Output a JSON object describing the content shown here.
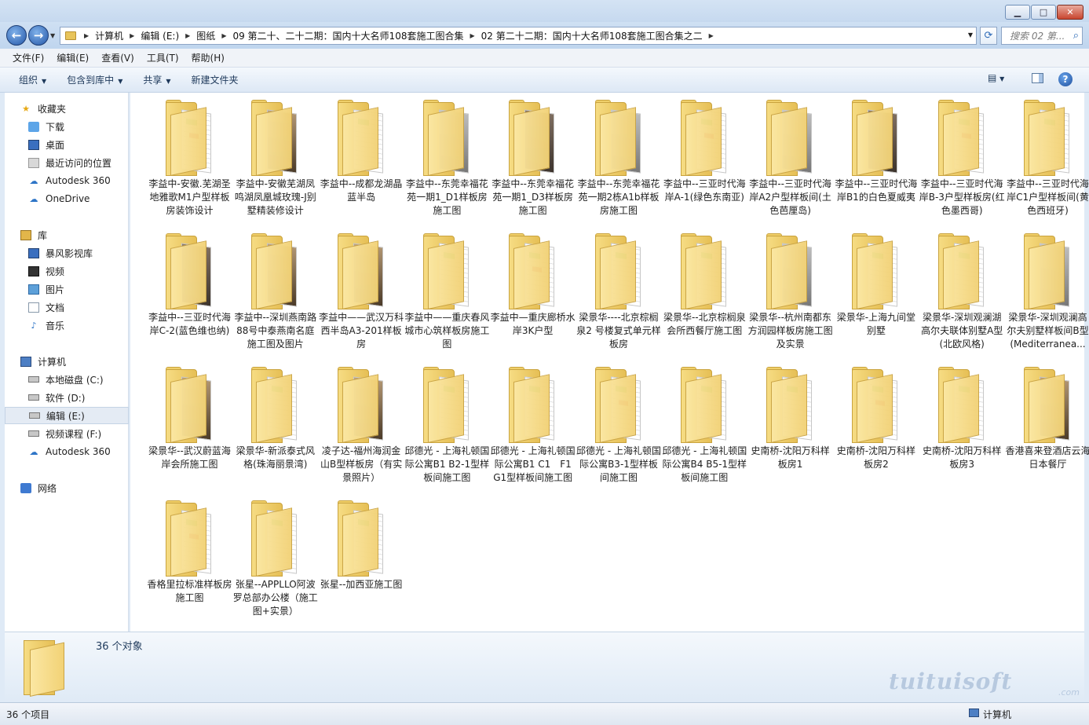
{
  "address": {
    "crumbs": [
      "计算机",
      "编辑 (E:)",
      "图纸",
      "09 第二十、二十二期：国内十大名师108套施工图合集",
      "02 第二十二期：国内十大名师108套施工图合集之二"
    ],
    "search_placeholder": "搜索 02 第..."
  },
  "menu": [
    "文件(F)",
    "编辑(E)",
    "查看(V)",
    "工具(T)",
    "帮助(H)"
  ],
  "toolbar": {
    "organize": "组织",
    "include": "包含到库中",
    "share": "共享",
    "new_folder": "新建文件夹"
  },
  "nav": {
    "favorites": "收藏夹",
    "fav_items": [
      "下载",
      "桌面",
      "最近访问的位置",
      "Autodesk 360",
      "OneDrive"
    ],
    "libraries": "库",
    "lib_items": [
      "暴风影视库",
      "视频",
      "图片",
      "文档",
      "音乐"
    ],
    "computer": "计算机",
    "drives": [
      "本地磁盘 (C:)",
      "软件 (D:)",
      "编辑 (E:)",
      "视频课程 (F:)",
      "Autodesk 360"
    ],
    "network": "网络"
  },
  "items": [
    {
      "name": "李益中-安徽.芜湖圣地雅歌M1户型样板房装饰设计",
      "thumb": "drawing"
    },
    {
      "name": "李益中-安徽芜湖凤鸣湖凤凰城玫瑰-J别墅精装修设计",
      "thumb": "photo"
    },
    {
      "name": "李益中--成都龙湖晶蓝半岛",
      "thumb": "drawing"
    },
    {
      "name": "李益中--东莞幸福花苑一期1_D1样板房施工图",
      "thumb": "gray"
    },
    {
      "name": "李益中--东莞幸福花苑一期1_D3样板房施工图",
      "thumb": "dark"
    },
    {
      "name": "李益中--东莞幸福花苑一期2栋A1b样板房施工图",
      "thumb": "gray"
    },
    {
      "name": "李益中--三亚时代海岸A-1(绿色东南亚)",
      "thumb": "drawing"
    },
    {
      "name": "李益中--三亚时代海岸A2户型样板间(土色芭厘岛)",
      "thumb": "gray"
    },
    {
      "name": "李益中--三亚时代海岸B1的白色夏威夷",
      "thumb": "dark"
    },
    {
      "name": "李益中--三亚时代海岸B-3户型样板房(红色墨西哥)",
      "thumb": "drawing"
    },
    {
      "name": "李益中--三亚时代海岸C1户型样板间(黄色西班牙)",
      "thumb": "drawing"
    },
    {
      "name": "李益中--三亚时代海岸C-2(蓝色维也纳)",
      "thumb": "dark"
    },
    {
      "name": "李益中--深圳燕南路88号中泰燕南名庭施工图及图片",
      "thumb": "photo"
    },
    {
      "name": "李益中——武汉万科西半岛A3-201样板房",
      "thumb": "photo"
    },
    {
      "name": "李益中——重庆春风城市心筑样板房施工图",
      "thumb": "drawing"
    },
    {
      "name": "李益中—重庆廊桥水岸3K户型",
      "thumb": "drawing"
    },
    {
      "name": "梁景华----北京棕榈泉2 号楼复式单元样板房",
      "thumb": "drawing"
    },
    {
      "name": "梁景华--北京棕榈泉会所西餐厅施工图",
      "thumb": "drawing"
    },
    {
      "name": "梁景华--杭州南都东方润园样板房施工图及实景",
      "thumb": "gray"
    },
    {
      "name": "梁景华-上海九间堂别墅",
      "thumb": "drawing"
    },
    {
      "name": "梁景华-深圳观澜湖高尔夫联体别墅A型(北欧风格)",
      "thumb": "drawing"
    },
    {
      "name": "梁景华-深圳观澜高尔夫别墅样板间B型(Mediterranea...",
      "thumb": "gray"
    },
    {
      "name": "梁景华--武汉蔚蓝海岸会所施工图",
      "thumb": "photo"
    },
    {
      "name": "梁景华-新派泰式风格(珠海丽景湾)",
      "thumb": "drawing"
    },
    {
      "name": "凌子达-福州海润金山B型样板房（有实景照片）",
      "thumb": "photo"
    },
    {
      "name": "邱德光 - 上海礼顿国际公寓B1 B2-1型样板间施工图",
      "thumb": "drawing"
    },
    {
      "name": "邱德光 - 上海礼顿国际公寓B1 C1　F1 G1型样板间施工图",
      "thumb": "drawing"
    },
    {
      "name": "邱德光 - 上海礼顿国际公寓B3-1型样板间施工图",
      "thumb": "drawing"
    },
    {
      "name": "邱德光 - 上海礼顿国际公寓B4 B5-1型样板间施工图",
      "thumb": "drawing"
    },
    {
      "name": "史南桥-沈阳万科样板房1",
      "thumb": "drawing"
    },
    {
      "name": "史南桥-沈阳万科样板房2",
      "thumb": "drawing"
    },
    {
      "name": "史南桥-沈阳万科样板房3",
      "thumb": "drawing"
    },
    {
      "name": "香港喜来登酒店云海日本餐厅",
      "thumb": "photo"
    },
    {
      "name": "香格里拉标准样板房施工图",
      "thumb": "drawing"
    },
    {
      "name": "张星--APPLLO阿波罗总部办公楼（施工图+实景）",
      "thumb": "drawing"
    },
    {
      "name": "张星--加西亚施工图",
      "thumb": "drawing"
    }
  ],
  "details": {
    "count": "36 个对象"
  },
  "watermark": {
    "text": "tuituisoft",
    "suffix": ".com"
  },
  "status": {
    "left": "36 个项目",
    "right": "计算机"
  }
}
